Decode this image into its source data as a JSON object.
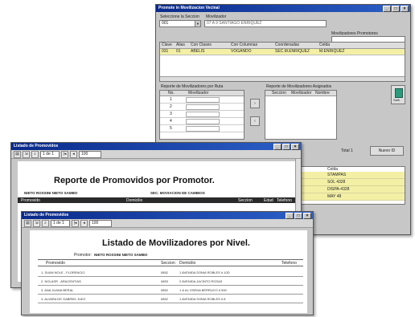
{
  "back_window": {
    "title": "Promote in Movilizacion Vecinal",
    "label_select": "Seleccione la Seccion",
    "label_movilizador": "Movilizador",
    "combo_value": "001",
    "field_value": "07 A 9 SANTIAGO ENRIQUEZ",
    "group_label": "Movilizadores Promotores",
    "table_headers": [
      "Clave",
      "Alias",
      "Con Clases",
      "Con Columnas",
      "Coordenadas",
      "Celda"
    ],
    "table_row": [
      "031",
      "01",
      "ABELIS",
      "VOGANDO",
      "SEC.M.ENRIQUEZ",
      "M.ENRIQUEZ"
    ],
    "left_panel_title": "Reporte de Movilizadores por Ruta",
    "left_panel_headers": [
      "No.",
      "Movilizador"
    ],
    "left_rows": [
      "1",
      "2",
      "3",
      "4",
      "5"
    ],
    "right_panel_title": "Reporte de Movilizadores Asignados",
    "right_panel_headers": [
      "Seccion",
      "Movilizador",
      "Nombre"
    ],
    "side_button": "Salir",
    "bottom_count": "Total 1",
    "nuevo_button": "Nuevo ID",
    "bottom_header": "Celda",
    "bottom_rows": [
      "STAMPAS",
      "SOL 4328",
      "DISPA-4328",
      "MAY 48"
    ]
  },
  "middle_window": {
    "title": "Listado de Promovidos",
    "toolbar_combo": "1 de 1",
    "zoom": "100",
    "report_title": "Reporte de Promovidos por Promotor.",
    "promotor_label": "NIETO ROSSINI NIETO SAMBO",
    "seccion_label": "SEC. MOVIACION DE CAMBIOS",
    "columns": [
      "Promovido",
      "Domicilio",
      "Seccion",
      "Edad",
      "Telefono"
    ]
  },
  "front_window": {
    "title": "Listado de Promovidos",
    "toolbar_combo": "1 de 1",
    "zoom": "100",
    "report_title": "Listado de Movilizadores por Nivel.",
    "promotor_prefix": "Promotor:",
    "promotor_name": "NIETO ROSSINI NIETO SAMBO",
    "columns": [
      "Promovido",
      "Seccion",
      "Domicilio",
      "Telefono"
    ],
    "rows": [
      [
        "1. SUAN NOLE  - FLORENCIO",
        "0852",
        "1 AVENIDA  SONIA ROBLES # 10D"
      ],
      [
        "2. NOLASR - ARACENTIAS",
        "0853",
        "2 AVENIDA JACINTO ROSAS"
      ],
      [
        "3. ANA JUANA BERAL",
        "0852",
        "1 & AL OSENA BERRUCO # 500"
      ],
      [
        "4. ALVARA DE GABRIEL JUEZ",
        "0852",
        "1 AVENIDA SONIA ROBLES # 8"
      ]
    ]
  }
}
